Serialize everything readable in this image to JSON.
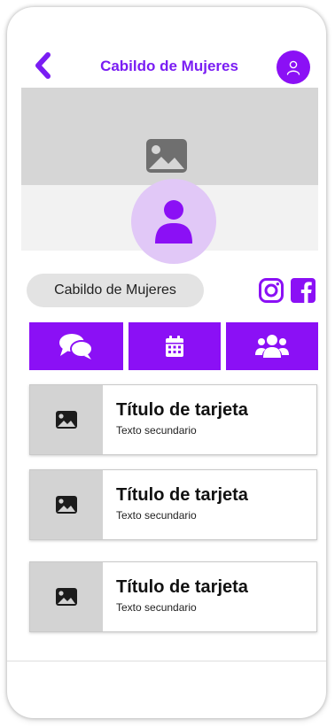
{
  "header": {
    "back_icon": "chevron-left-icon",
    "title": "Cabildo de Mujeres",
    "user_icon": "user-icon"
  },
  "cover": {
    "placeholder_icon": "image-icon"
  },
  "profile": {
    "avatar_icon": "user-icon",
    "name": "Cabildo de Mujeres",
    "social": [
      "instagram-icon",
      "facebook-icon"
    ]
  },
  "actions": [
    {
      "icon": "chat-icon"
    },
    {
      "icon": "calendar-icon"
    },
    {
      "icon": "users-icon"
    }
  ],
  "cards": [
    {
      "title": "Título de tarjeta",
      "subtitle": "Texto secundario",
      "icon": "image-icon"
    },
    {
      "title": "Título de tarjeta",
      "subtitle": "Texto secundario",
      "icon": "image-icon"
    },
    {
      "title": "Título de tarjeta",
      "subtitle": "Texto secundario",
      "icon": "image-icon"
    }
  ],
  "colors": {
    "accent": "#8b10f5",
    "title": "#7a1df3",
    "avatar_bg": "#e1c8f7"
  }
}
